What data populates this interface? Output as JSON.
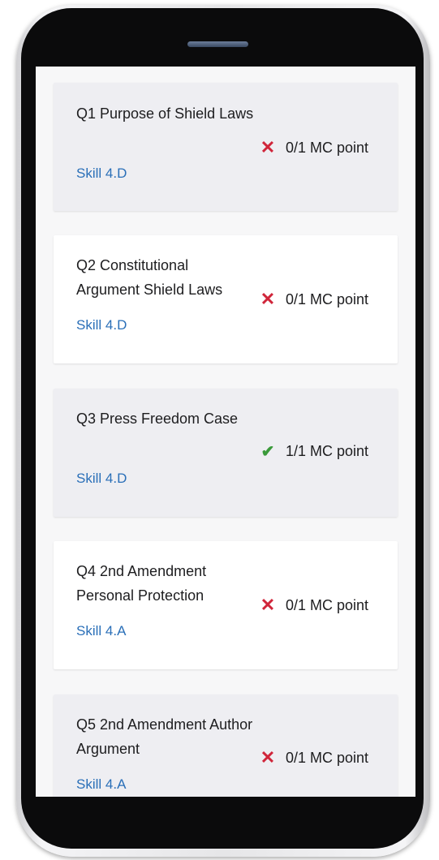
{
  "questions": [
    {
      "title": "Q1 Purpose of Shield Laws",
      "skill": "Skill 4.D",
      "result": "incorrect",
      "score": "0/1 MC point"
    },
    {
      "title": "Q2 Constitutional Argument Shield Laws",
      "skill": "Skill 4.D",
      "result": "incorrect",
      "score": "0/1 MC point"
    },
    {
      "title": "Q3 Press Freedom Case",
      "skill": "Skill 4.D",
      "result": "correct",
      "score": "1/1 MC point"
    },
    {
      "title": "Q4 2nd Amendment Personal Protection",
      "skill": "Skill 4.A",
      "result": "incorrect",
      "score": "0/1 MC point"
    },
    {
      "title": "Q5 2nd Amendment Author Argument",
      "skill": "Skill 4.A",
      "result": "incorrect",
      "score": "0/1 MC point"
    }
  ],
  "icons": {
    "incorrect": "close-x-icon",
    "correct": "checkmark-icon"
  },
  "colors": {
    "incorrect": "#d0253a",
    "correct": "#3a9a3a",
    "skill_link": "#2a6fb8",
    "card_shaded": "#eeeef2",
    "card_white": "#ffffff"
  }
}
